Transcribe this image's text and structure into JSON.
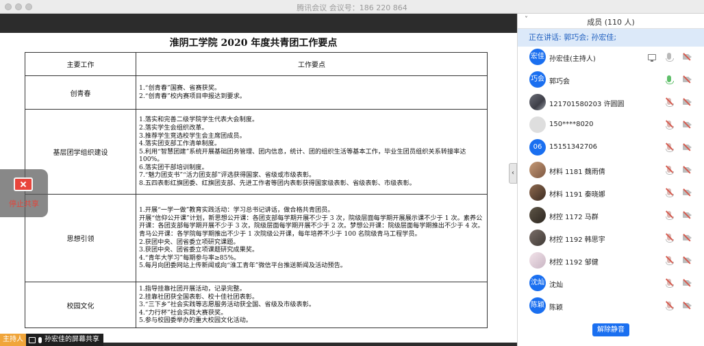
{
  "window": {
    "title": "腾讯会议 会议号：186 220 864"
  },
  "document": {
    "title": "淮阴工学院 2020 年度共青团工作要点",
    "col_headers": [
      "主要工作",
      "工作要点"
    ],
    "rows": [
      {
        "category": "创青春",
        "points": [
          "1.“创青春”国赛、省赛获奖。",
          "2.“创青春”校内赛项目申报达到要求。"
        ]
      },
      {
        "category": "基层团学组织建设",
        "points": [
          "1.落实和完善二级学院学生代表大会制度。",
          "2.落实学生会组织改革。",
          "3.推荐学生竞选校学生会主席团成员。",
          "4.落实团支部工作清单制度。",
          "5.利用“智慧团建”系统开展基础团务管理、团内信息，统计、团的组织生活等基本工作，毕业生团员组织关系转接率达 100%。",
          "6.落实团干部培训制度。",
          "7.“魅力团支书”“活力团支部”评选获得国家、省级或市级表彰。",
          "8.五四表彰红旗团委、红旗团支部、先进工作者等团内表彰获得国家级表彰、省级表彰、市级表彰。"
        ]
      },
      {
        "category": "思想引领",
        "points": [
          "1.开展“一学一做”教育实践活动：学习总书记讲话，做合格共青团员。",
          "开展“信仰公开课”计划，新思想公开课：各团支部每学期开展不少于 3 次，院级层面每学期开展展示课不少于 1 次。素养公开课：各团支部每学期开展不少于 3 次，院级层面每学期开展不少于 2 次。梦想公开课：院级层面每学期推出不少于 4 次。青马公开课：各学院每学期推出不少于 1 次院级公开课，每年培养不少于 100 名院级青马工程学员。",
          "2.获团中央、团省委立项研究课题。",
          "3.获团中央、团省委立项课题研究成果奖。",
          "4.“青年大学习”每期参与率≥85%。",
          "5.每月向团委网站上传新闻或向“淮工青年”微信平台推送新闻及活动预告。"
        ]
      },
      {
        "category": "校园文化",
        "points": [
          "1.指导挂靠社团开展活动，记录完整。",
          "2.挂靠社团获全国表彰、校十佳社团表彰。",
          "3.“三下乡”社会实践等志愿服务活动获全国、省级及市级表彰。",
          "4.“力行杯”社会实践大赛获奖。",
          "5.参与校园委举办的重大校园文化活动。"
        ]
      }
    ]
  },
  "overlay": {
    "stop_share_label": "停止共享"
  },
  "bottombar": {
    "host_badge": "主持人",
    "share_text": "孙宏佳的屏幕共享"
  },
  "collapse_handle": "‹",
  "panel": {
    "title": "成员 (110 人)",
    "chevron": "˅",
    "speaking": "正在讲话: 郭巧会; 孙宏佳;",
    "members": [
      {
        "name": "孙宏佳(主持人)",
        "avatar_text": "宏佳",
        "avatar_type": "text",
        "sharing": true,
        "mic": "normal",
        "cam": "on"
      },
      {
        "name": "郭巧会",
        "avatar_text": "巧会",
        "avatar_type": "text",
        "sharing": false,
        "mic": "active",
        "cam": "on"
      },
      {
        "name": "121701580203 许圆圆",
        "avatar_text": "",
        "avatar_type": "photo1",
        "sharing": false,
        "mic": "muted",
        "cam": "on"
      },
      {
        "name": "150****8020",
        "avatar_text": "",
        "avatar_type": "gray",
        "sharing": false,
        "mic": "muted",
        "cam": "on"
      },
      {
        "name": "15151342706",
        "avatar_text": "06",
        "avatar_type": "text",
        "sharing": false,
        "mic": "muted",
        "cam": "on"
      },
      {
        "name": "材料 1181 魏雨倩",
        "avatar_text": "",
        "avatar_type": "photo2",
        "sharing": false,
        "mic": "muted",
        "cam": "on"
      },
      {
        "name": "材料 1191 秦晓娜",
        "avatar_text": "",
        "avatar_type": "photo3",
        "sharing": false,
        "mic": "muted",
        "cam": "on"
      },
      {
        "name": "材控 1172 马群",
        "avatar_text": "",
        "avatar_type": "photo5",
        "sharing": false,
        "mic": "muted",
        "cam": "on"
      },
      {
        "name": "材控 1192 韩思宇",
        "avatar_text": "",
        "avatar_type": "photo6",
        "sharing": false,
        "mic": "muted",
        "cam": "on"
      },
      {
        "name": "材控 1192 邹健",
        "avatar_text": "",
        "avatar_type": "photo7",
        "sharing": false,
        "mic": "muted",
        "cam": "on"
      },
      {
        "name": "沈灿",
        "avatar_text": "沈灿",
        "avatar_type": "text",
        "sharing": false,
        "mic": "muted",
        "cam": "on"
      },
      {
        "name": "陈颖",
        "avatar_text": "陈颖",
        "avatar_type": "text",
        "sharing": false,
        "mic": "muted",
        "cam": "on"
      }
    ],
    "unmute_button": "解除静音"
  }
}
